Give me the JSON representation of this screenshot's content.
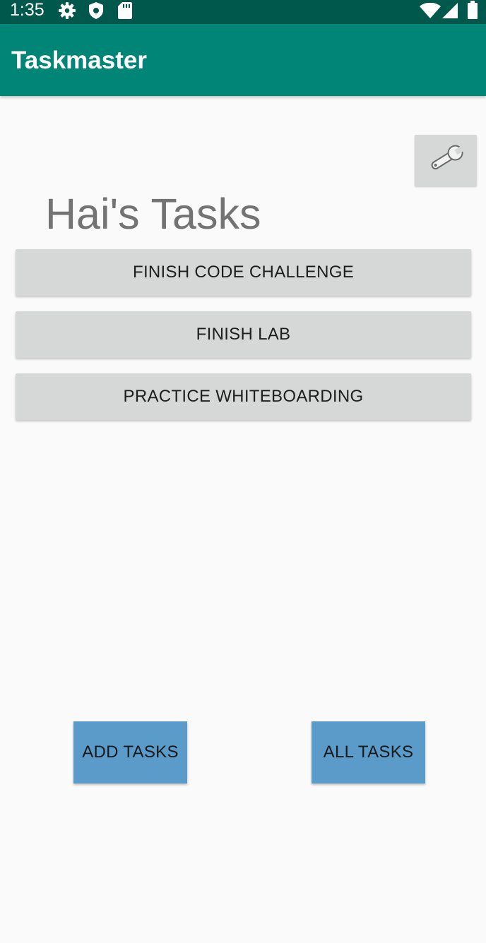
{
  "status_bar": {
    "time": "1:35",
    "icons": [
      "gear-icon",
      "shield-icon",
      "sd-card-icon",
      "wifi-icon",
      "signal-icon",
      "battery-icon"
    ]
  },
  "app_bar": {
    "title": "Taskmaster",
    "color": "#008577"
  },
  "settings": {
    "icon": "wrench-icon"
  },
  "heading": "Hai's Tasks",
  "tasks": [
    {
      "label": "FINISH CODE CHALLENGE"
    },
    {
      "label": "FINISH LAB"
    },
    {
      "label": "PRACTICE WHITEBOARDING"
    }
  ],
  "actions": {
    "add_label": "ADD TASKS",
    "all_label": "ALL TASKS",
    "color": "#5b9bc9"
  }
}
